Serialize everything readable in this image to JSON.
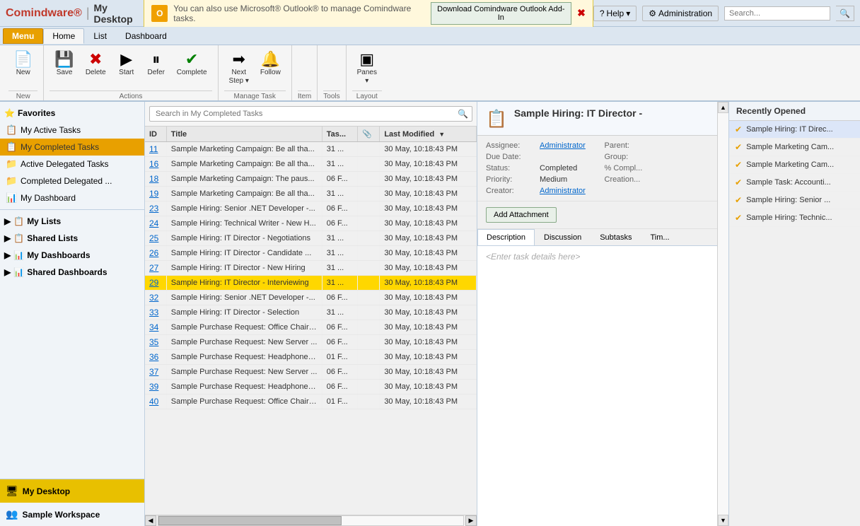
{
  "app": {
    "logo": "Comindware®",
    "title": "My Desktop"
  },
  "topbar": {
    "outlook_msg": "You can also use Microsoft® Outlook® to manage Comindware tasks.",
    "outlook_download": "Download Comindware Outlook Add-In",
    "help_label": "Help",
    "admin_label": "Administration",
    "search_placeholder": "Search..."
  },
  "nav_tabs": [
    {
      "label": "Menu",
      "type": "menu"
    },
    {
      "label": "Home",
      "type": "active"
    },
    {
      "label": "List",
      "type": "normal"
    },
    {
      "label": "Dashboard",
      "type": "normal"
    }
  ],
  "ribbon": {
    "groups": [
      {
        "label": "New",
        "buttons": [
          {
            "icon": "📄",
            "label": "New"
          }
        ]
      },
      {
        "label": "Actions",
        "buttons": [
          {
            "icon": "💾",
            "label": "Save"
          },
          {
            "icon": "✖",
            "label": "Delete",
            "color": "red"
          },
          {
            "icon": "▶",
            "label": "Start"
          },
          {
            "icon": "⏸",
            "label": "Defer"
          },
          {
            "icon": "✔",
            "label": "Complete",
            "color": "green"
          }
        ]
      },
      {
        "label": "Manage Task",
        "buttons": [
          {
            "icon": "➡",
            "label": "Next Step ▼"
          },
          {
            "icon": "🔔",
            "label": "Follow"
          }
        ]
      },
      {
        "label": "Item",
        "buttons": []
      },
      {
        "label": "Tools",
        "buttons": []
      },
      {
        "label": "Layout",
        "buttons": [
          {
            "icon": "▣",
            "label": "Panes"
          }
        ]
      }
    ]
  },
  "sidebar": {
    "favorites_label": "Favorites",
    "items": [
      {
        "label": "My Active Tasks",
        "icon": "📋",
        "active": false
      },
      {
        "label": "My Completed Tasks",
        "icon": "📋",
        "active": true
      }
    ],
    "groups": [
      {
        "label": "Active Delegated Tasks",
        "icon": "📁",
        "expanded": false
      },
      {
        "label": "Completed Delegated ...",
        "icon": "📁",
        "expanded": false
      },
      {
        "label": "My Dashboard",
        "icon": "📊",
        "expanded": false
      }
    ],
    "sections": [
      {
        "label": "My Lists",
        "expanded": false
      },
      {
        "label": "Shared Lists",
        "expanded": false
      },
      {
        "label": "My Dashboards",
        "expanded": false
      },
      {
        "label": "Shared Dashboards",
        "expanded": false
      }
    ],
    "footer": [
      {
        "label": "My Desktop",
        "icon": "🖥",
        "active": true
      },
      {
        "label": "Sample Workspace",
        "icon": "👥",
        "active": false
      }
    ]
  },
  "task_list": {
    "search_placeholder": "Search in My Completed Tasks",
    "columns": [
      {
        "label": "ID",
        "key": "id"
      },
      {
        "label": "Title",
        "key": "title"
      },
      {
        "label": "Tas...",
        "key": "task"
      },
      {
        "label": "📎",
        "key": "attach"
      },
      {
        "label": "Last Modified",
        "key": "modified",
        "sort": "▼"
      }
    ],
    "rows": [
      {
        "id": "11",
        "title": "Sample Marketing Campaign: Be all tha...",
        "task": "31 ...",
        "attach": "",
        "modified": "30 May, 10:18:43 PM",
        "selected": false
      },
      {
        "id": "16",
        "title": "Sample Marketing Campaign: Be all tha...",
        "task": "31 ...",
        "attach": "",
        "modified": "30 May, 10:18:43 PM",
        "selected": false
      },
      {
        "id": "18",
        "title": "Sample Marketing Campaign: The paus...",
        "task": "06 F...",
        "attach": "",
        "modified": "30 May, 10:18:43 PM",
        "selected": false
      },
      {
        "id": "19",
        "title": "Sample Marketing Campaign: Be all tha...",
        "task": "31 ...",
        "attach": "",
        "modified": "30 May, 10:18:43 PM",
        "selected": false
      },
      {
        "id": "23",
        "title": "Sample Hiring: Senior .NET Developer -...",
        "task": "06 F...",
        "attach": "",
        "modified": "30 May, 10:18:43 PM",
        "selected": false
      },
      {
        "id": "24",
        "title": "Sample Hiring: Technical Writer - New H...",
        "task": "06 F...",
        "attach": "",
        "modified": "30 May, 10:18:43 PM",
        "selected": false
      },
      {
        "id": "25",
        "title": "Sample Hiring: IT Director - Negotiations",
        "task": "31 ...",
        "attach": "",
        "modified": "30 May, 10:18:43 PM",
        "selected": false
      },
      {
        "id": "26",
        "title": "Sample Hiring: IT Director - Candidate ...",
        "task": "31 ...",
        "attach": "",
        "modified": "30 May, 10:18:43 PM",
        "selected": false
      },
      {
        "id": "27",
        "title": "Sample Hiring: IT Director - New Hiring",
        "task": "31 ...",
        "attach": "",
        "modified": "30 May, 10:18:43 PM",
        "selected": false
      },
      {
        "id": "29",
        "title": "Sample Hiring: IT Director - Interviewing",
        "task": "31 ...",
        "attach": "",
        "modified": "30 May, 10:18:43 PM",
        "selected": true
      },
      {
        "id": "32",
        "title": "Sample Hiring: Senior .NET Developer -...",
        "task": "06 F...",
        "attach": "",
        "modified": "30 May, 10:18:43 PM",
        "selected": false
      },
      {
        "id": "33",
        "title": "Sample Hiring: IT Director - Selection",
        "task": "31 ...",
        "attach": "",
        "modified": "30 May, 10:18:43 PM",
        "selected": false
      },
      {
        "id": "34",
        "title": "Sample Purchase Request: Office Chair ...",
        "task": "06 F...",
        "attach": "",
        "modified": "30 May, 10:18:43 PM",
        "selected": false
      },
      {
        "id": "35",
        "title": "Sample Purchase Request: New Server ...",
        "task": "06 F...",
        "attach": "",
        "modified": "30 May, 10:18:43 PM",
        "selected": false
      },
      {
        "id": "36",
        "title": "Sample Purchase Request: Headphones...",
        "task": "01 F...",
        "attach": "",
        "modified": "30 May, 10:18:43 PM",
        "selected": false
      },
      {
        "id": "37",
        "title": "Sample Purchase Request: New Server ...",
        "task": "06 F...",
        "attach": "",
        "modified": "30 May, 10:18:43 PM",
        "selected": false
      },
      {
        "id": "39",
        "title": "Sample Purchase Request: Headphones...",
        "task": "06 F...",
        "attach": "",
        "modified": "30 May, 10:18:43 PM",
        "selected": false
      },
      {
        "id": "40",
        "title": "Sample Purchase Request: Office Chair ...",
        "task": "01 F...",
        "attach": "",
        "modified": "30 May, 10:18:43 PM",
        "selected": false
      }
    ]
  },
  "detail": {
    "title": "Sample Hiring: IT Director -",
    "icon": "📋",
    "assignee_label": "Assignee:",
    "assignee_value": "Administrator",
    "due_date_label": "Due Date:",
    "due_date_value": "",
    "status_label": "Status:",
    "status_value": "Completed",
    "priority_label": "Priority:",
    "priority_value": "Medium",
    "creator_label": "Creator:",
    "creator_value": "Administrator",
    "parent_label": "Parent:",
    "parent_value": "",
    "group_label": "Group:",
    "group_value": "",
    "pct_complete_label": "% Compl...",
    "pct_complete_value": "",
    "creation_label": "Creation...",
    "creation_value": "",
    "add_attachment_label": "Add Attachment",
    "tabs": [
      "Description",
      "Discussion",
      "Subtasks",
      "Tim..."
    ],
    "body_placeholder": "<Enter task details here>"
  },
  "recently_opened": {
    "header": "Recently Opened",
    "items": [
      {
        "label": "Sample Hiring: IT Direc...",
        "active": true
      },
      {
        "label": "Sample Marketing Cam...",
        "active": false
      },
      {
        "label": "Sample Marketing Cam...",
        "active": false
      },
      {
        "label": "Sample Task: Accounti...",
        "active": false
      },
      {
        "label": "Sample Hiring: Senior ...",
        "active": false
      },
      {
        "label": "Sample Hiring: Technic...",
        "active": false
      }
    ]
  }
}
